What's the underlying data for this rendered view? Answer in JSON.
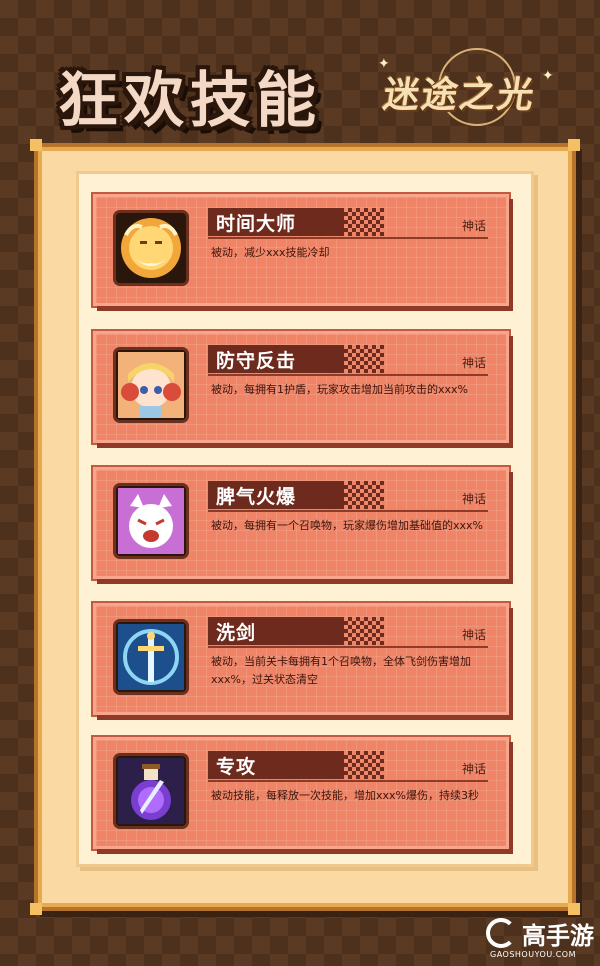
{
  "page": {
    "title": "狂欢技能",
    "logo_text": "迷途之光"
  },
  "colors": {
    "background": "#5a3a22",
    "card": "#ef8466",
    "name_bar": "#6e2a1c",
    "board": "#fbd9a3"
  },
  "skills": [
    {
      "name": "时间大师",
      "rank": "神话",
      "desc": "被动，减少xxx技能冷却",
      "icon": "golden-old-man-icon"
    },
    {
      "name": "防守反击",
      "rank": "神话",
      "desc": "被动，每拥有1护盾，玩家攻击增加当前攻击的xxx%",
      "icon": "blonde-girl-icon"
    },
    {
      "name": "脾气火爆",
      "rank": "神话",
      "desc": "被动，每拥有一个召唤物，玩家爆伤增加基础值的xxx%",
      "icon": "angry-fox-icon"
    },
    {
      "name": "洗剑",
      "rank": "神话",
      "desc": "被动，当前关卡每拥有1个召唤物，全体飞剑伤害增加xxx%，过关状态清空",
      "icon": "sword-icon"
    },
    {
      "name": "专攻",
      "rank": "神话",
      "desc": "被动技能，每释放一次技能，增加xxx%爆伤，持续3秒",
      "icon": "potion-bottle-icon"
    }
  ],
  "watermark": {
    "text": "高手游",
    "sub": "GAOSHOUYOU.COM"
  }
}
